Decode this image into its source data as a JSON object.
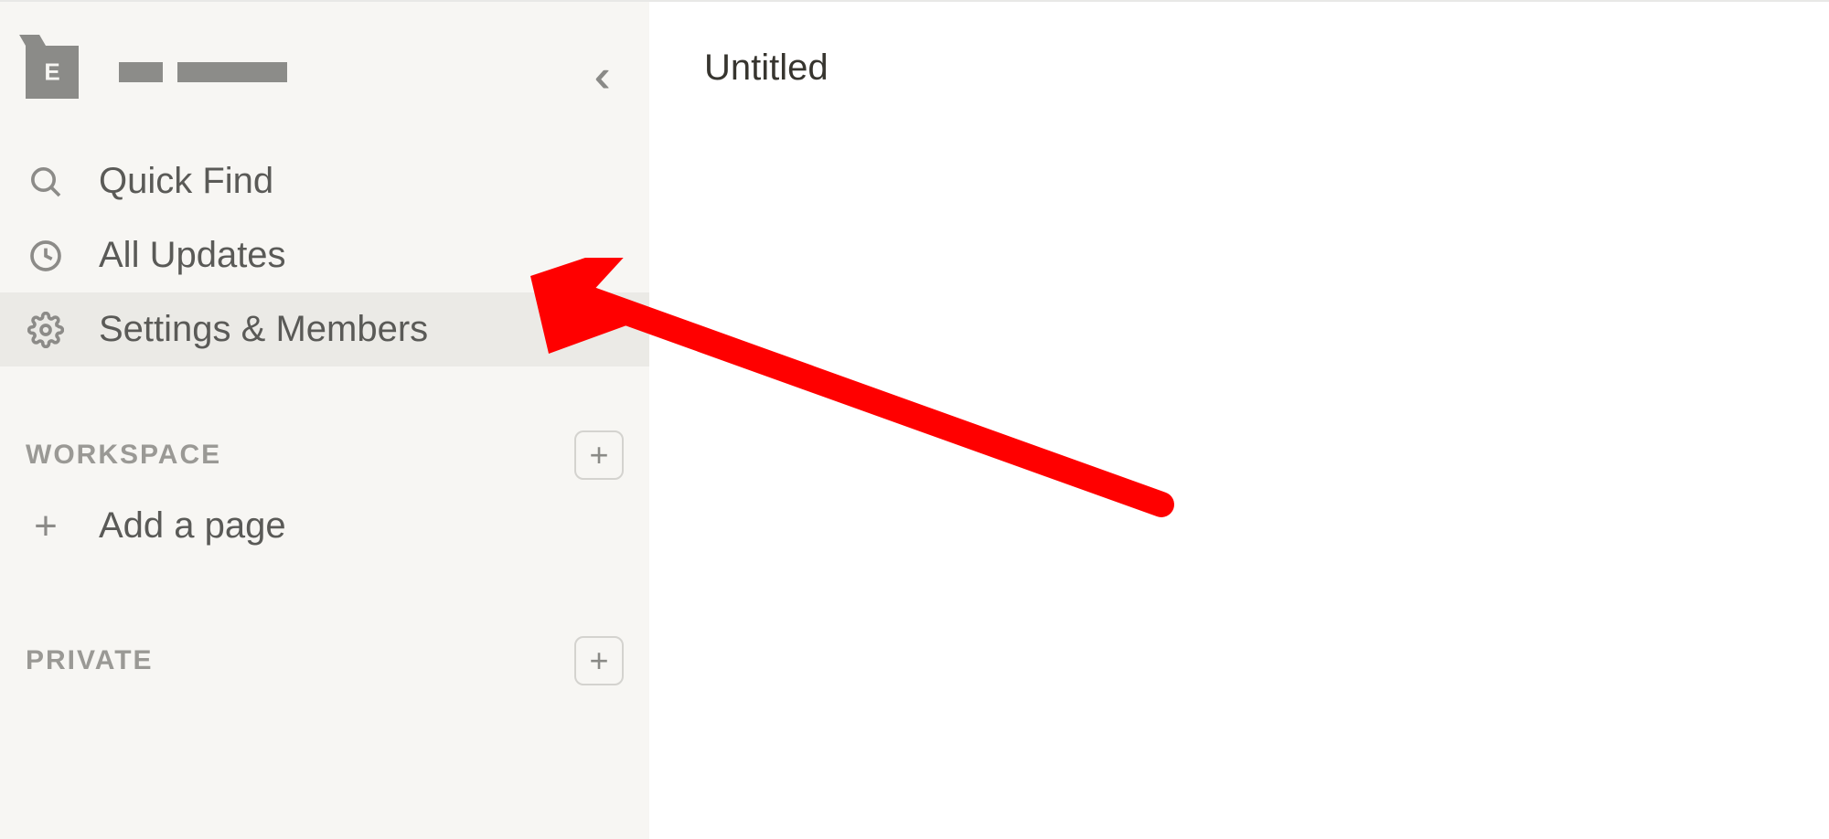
{
  "workspace": {
    "logo_letter": "E"
  },
  "sidebar": {
    "nav": [
      {
        "label": "Quick Find",
        "icon": "search"
      },
      {
        "label": "All Updates",
        "icon": "clock"
      },
      {
        "label": "Settings & Members",
        "icon": "gear"
      }
    ],
    "sections": [
      {
        "title": "WORKSPACE",
        "items": [
          {
            "label": "Add a page"
          }
        ]
      },
      {
        "title": "PRIVATE",
        "items": []
      }
    ]
  },
  "main": {
    "page_title": "Untitled"
  },
  "annotation": {
    "target": "settings-members"
  }
}
